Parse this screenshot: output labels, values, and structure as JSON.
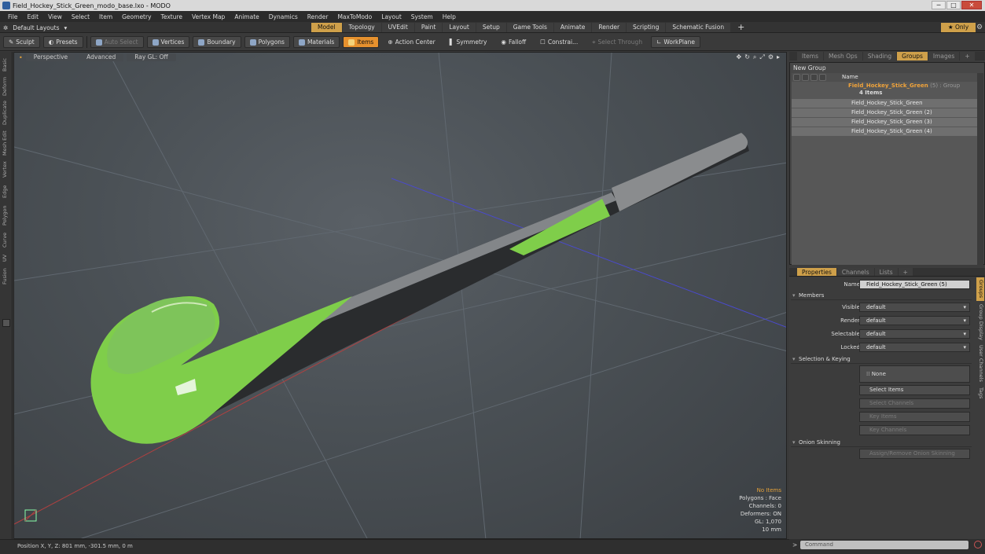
{
  "window": {
    "title": "Field_Hockey_Stick_Green_modo_base.lxo - MODO",
    "min": "─",
    "max": "□",
    "close": "✕"
  },
  "menu": [
    "File",
    "Edit",
    "View",
    "Select",
    "Item",
    "Geometry",
    "Texture",
    "Vertex Map",
    "Animate",
    "Dynamics",
    "Render",
    "MaxToModo",
    "Layout",
    "System",
    "Help"
  ],
  "layouts": {
    "dropdown": "Default Layouts",
    "tabs": [
      "Model",
      "Topology",
      "UVEdit",
      "Paint",
      "Layout",
      "Setup",
      "Game Tools",
      "Animate",
      "Render",
      "Scripting",
      "Schematic Fusion"
    ],
    "active": "Model",
    "plus": "+",
    "only": "Only"
  },
  "toolbar": {
    "sculpt": "Sculpt",
    "presets": "Presets",
    "auto_select": "Auto Select",
    "vertices": "Vertices",
    "boundary": "Boundary",
    "polygons": "Polygons",
    "materials": "Materials",
    "items": "Items",
    "action_center": "Action Center",
    "symmetry": "Symmetry",
    "falloff": "Falloff",
    "constrain": "Constrai...",
    "select_through": "Select Through",
    "workplane": "WorkPlane"
  },
  "left_tabs": [
    "Basic",
    "Deform",
    "Duplicate",
    "Mesh Edit",
    "Vertex",
    "Edge",
    "Polygon",
    "Curve",
    "UV",
    "Fusion"
  ],
  "viewport": {
    "tabs": [
      "Perspective",
      "Advanced",
      "Ray GL: Off"
    ],
    "info": {
      "no_items": "No Items",
      "polygons": "Polygons : Face",
      "channels": "Channels: 0",
      "deformers": "Deformers: ON",
      "gl": "GL: 1,070",
      "scale": "10 mm"
    },
    "colors": {
      "stick_green": "#7fce4a",
      "stick_dark": "#2a2c2e",
      "grid": "#5e646a"
    }
  },
  "status": {
    "position": "Position X, Y, Z:  801 mm, -301.5 mm, 0 m"
  },
  "outliner": {
    "tabs": [
      "Items",
      "Mesh Ops",
      "Shading",
      "Groups",
      "Images",
      "+"
    ],
    "active": "Groups",
    "new_group": "New Group",
    "header": "Name",
    "group": {
      "name": "Field_Hockey_Stick_Green",
      "suffix": "(5) : Group",
      "count": "4 Items"
    },
    "items": [
      "Field_Hockey_Stick_Green",
      "Field_Hockey_Stick_Green (2)",
      "Field_Hockey_Stick_Green (3)",
      "Field_Hockey_Stick_Green (4)"
    ]
  },
  "properties": {
    "tabs": [
      "Properties",
      "Channels",
      "Lists",
      "+"
    ],
    "active": "Properties",
    "name_label": "Name",
    "name_value": "Field_Hockey_Stick_Green (5)",
    "members": "Members",
    "rows": [
      {
        "label": "Visible",
        "value": "default"
      },
      {
        "label": "Render",
        "value": "default"
      },
      {
        "label": "Selectable",
        "value": "default"
      },
      {
        "label": "Locked",
        "value": "default"
      }
    ],
    "sel_keying": "Selection & Keying",
    "none": "None",
    "select_items": "Select Items",
    "select_channels": "Select Channels",
    "key_items": "Key Items",
    "key_channels": "Key Channels",
    "onion": "Onion Skinning",
    "assign": "Assign/Remove Onion Skinning"
  },
  "side_tabs": [
    "Groups",
    "Group Display",
    "User Channels",
    "Tags"
  ],
  "command": {
    "placeholder": "Command",
    "prompt": ">"
  }
}
